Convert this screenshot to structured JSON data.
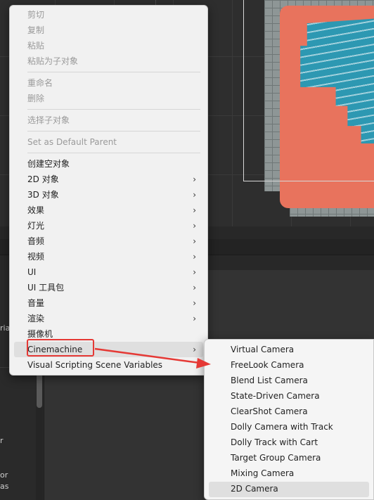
{
  "menu": {
    "items": [
      {
        "label": "剪切",
        "disabled": true
      },
      {
        "label": "复制",
        "disabled": true
      },
      {
        "label": "粘贴",
        "disabled": true
      },
      {
        "label": "粘贴为子对象",
        "disabled": true
      },
      {
        "label": "重命名",
        "disabled": true
      },
      {
        "label": "删除",
        "disabled": true
      },
      {
        "label": "选择子对象",
        "disabled": true
      },
      {
        "label": "Set as Default Parent",
        "disabled": true
      },
      {
        "label": "创建空对象",
        "disabled": false
      },
      {
        "label": "2D 对象",
        "disabled": false,
        "submenu": true
      },
      {
        "label": "3D 对象",
        "disabled": false,
        "submenu": true
      },
      {
        "label": "效果",
        "disabled": false,
        "submenu": true
      },
      {
        "label": "灯光",
        "disabled": false,
        "submenu": true
      },
      {
        "label": "音频",
        "disabled": false,
        "submenu": true
      },
      {
        "label": "视频",
        "disabled": false,
        "submenu": true
      },
      {
        "label": "UI",
        "disabled": false,
        "submenu": true
      },
      {
        "label": "UI 工具包",
        "disabled": false,
        "submenu": true
      },
      {
        "label": "音量",
        "disabled": false,
        "submenu": true
      },
      {
        "label": "渲染",
        "disabled": false,
        "submenu": true
      },
      {
        "label": "摄像机",
        "disabled": false
      },
      {
        "label": "Cinemachine",
        "disabled": false,
        "submenu": true,
        "highlighted": true
      },
      {
        "label": "Visual Scripting Scene Variables",
        "disabled": false
      }
    ],
    "submenu_arrow": "›"
  },
  "submenu": {
    "items": [
      {
        "label": "Virtual Camera"
      },
      {
        "label": "FreeLook Camera"
      },
      {
        "label": "Blend List Camera"
      },
      {
        "label": "State-Driven Camera"
      },
      {
        "label": "ClearShot Camera"
      },
      {
        "label": "Dolly Camera with Track"
      },
      {
        "label": "Dolly Track with Cart"
      },
      {
        "label": "Target Group Camera"
      },
      {
        "label": "Mixing Camera"
      },
      {
        "label": "2D Camera",
        "highlighted": true
      }
    ]
  },
  "background_panel": {
    "partial_labels": [
      "ria",
      "r",
      "or",
      "as"
    ]
  },
  "colors": {
    "annotation_red": "#e53935",
    "menu_bg": "#f1f1f1",
    "highlight": "#dfdfdf",
    "editor_bg": "#282828",
    "sand": "#e8735d",
    "water": "#2d98b2"
  }
}
